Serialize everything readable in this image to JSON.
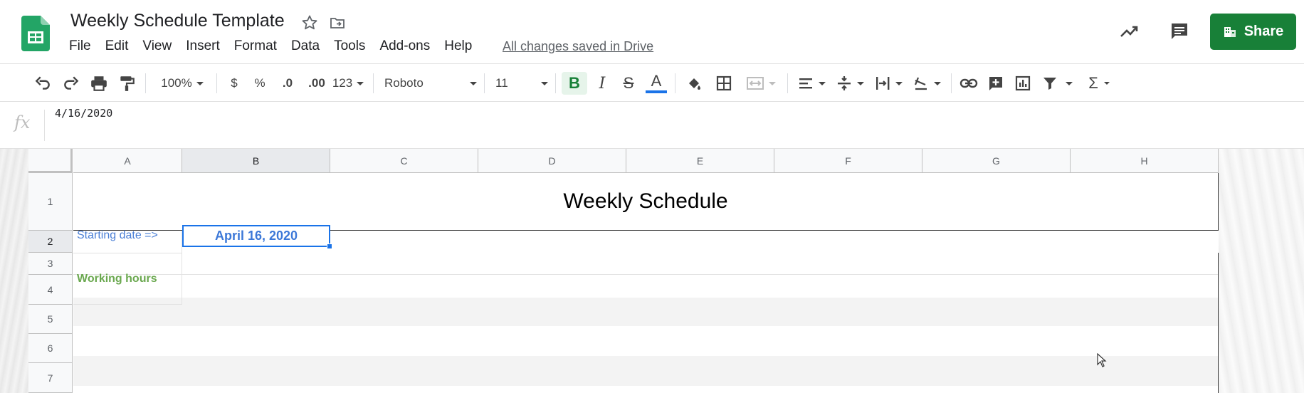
{
  "app": {
    "doc_title": "Weekly Schedule Template",
    "menu": [
      "File",
      "Edit",
      "View",
      "Insert",
      "Format",
      "Data",
      "Tools",
      "Add-ons",
      "Help"
    ],
    "save_status": "All changes saved in Drive",
    "share_label": "Share",
    "icons": [
      "sheets-logo",
      "star-icon",
      "move-to-folder-icon",
      "activity-trend-icon",
      "comments-icon",
      "share-building-icon"
    ]
  },
  "toolbar": {
    "zoom": "100%",
    "currency": "$",
    "percent": "%",
    "decrease_decimal": ".0",
    "increase_decimal": ".00",
    "more_formats": "123",
    "font_family": "Roboto",
    "font_size": "11",
    "bold": "B",
    "italic": "I",
    "strikethrough": "S",
    "text_color": "A",
    "functions": "Σ",
    "accent_colors": {
      "bold_active": "#188038",
      "text_color_bar": "#1a73e8"
    }
  },
  "formula_bar": {
    "fx_label": "fx",
    "value": "4/16/2020"
  },
  "sheet": {
    "columns": [
      "A",
      "B",
      "C",
      "D",
      "E",
      "F",
      "G",
      "H"
    ],
    "rows": [
      "1",
      "2",
      "3",
      "4",
      "5",
      "6",
      "7"
    ],
    "selected_column": "B",
    "selected_row": "2",
    "title": "Weekly Schedule",
    "starting_label": "Starting date =>",
    "start_date": "April 16, 2020",
    "working_hours_label": "Working hours",
    "colors": {
      "starting_label": "#4a7fd6",
      "working_hours_label": "#6aa84f",
      "date": "#3c78d8",
      "selection": "#1a73e8"
    }
  }
}
